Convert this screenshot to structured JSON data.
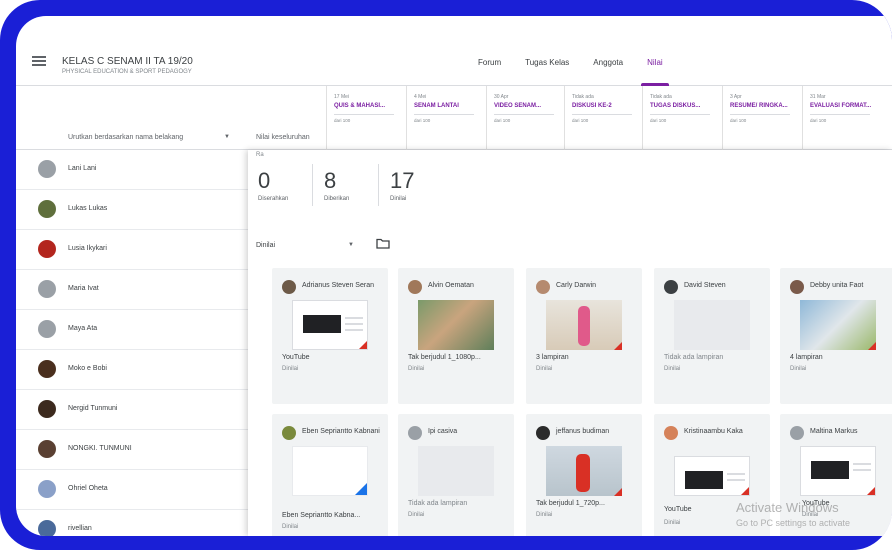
{
  "header": {
    "class_title": "KELAS C SENAM II TA 19/20",
    "class_subtitle": "PHYSICAL EDUCATION & SPORT PEDAGOGY",
    "tabs": [
      {
        "label": "Forum",
        "active": false
      },
      {
        "label": "Tugas Kelas",
        "active": false
      },
      {
        "label": "Anggota",
        "active": false
      },
      {
        "label": "Nilai",
        "active": true
      }
    ]
  },
  "grades": {
    "sort_label": "Urutkan berdasarkan nama belakang",
    "overall_label": "Nilai keseluruhan",
    "assignments": [
      {
        "due": "17 Mei",
        "name": "QUIS & MAHASI...",
        "max": "dari 100"
      },
      {
        "due": "4 Mei",
        "name": "SENAM LANTAI",
        "max": "dari 100"
      },
      {
        "due": "30 Apr",
        "name": "VIDEO SENAM...",
        "max": "dari 100"
      },
      {
        "due": "Tidak ada",
        "name": "DISKUSI KE-2",
        "max": "dari 100"
      },
      {
        "due": "Tidak ada",
        "name": "TUGAS DISKUS...",
        "max": "dari 100"
      },
      {
        "due": "3 Apr",
        "name": "RESUME/ RINGKA...",
        "max": "dari 100"
      },
      {
        "due": "31 Mar",
        "name": "EVALUASI FORMAT...",
        "max": "dari 100"
      }
    ]
  },
  "students": [
    {
      "name": "Lani Lani",
      "color": "#9aa0a6"
    },
    {
      "name": "Lukas Lukas",
      "color": "#5f6f3c"
    },
    {
      "name": "Lusia Ikykari",
      "color": "#b3261e"
    },
    {
      "name": "Maria Ivat",
      "color": "#9aa0a6"
    },
    {
      "name": "Maya Ata",
      "color": "#9aa0a6"
    },
    {
      "name": "Moko e Bobi",
      "color": "#4a2f1e"
    },
    {
      "name": "Nergid Tunmuni",
      "color": "#3c2a1e"
    },
    {
      "name": "NONGKI. TUNMUNI",
      "color": "#5a4032"
    },
    {
      "name": "Ohriel Oheta",
      "color": "#8aa0c8"
    },
    {
      "name": "rivellian",
      "color": "#4a6a9a"
    }
  ],
  "panel": {
    "top_label": "Ra",
    "stats": [
      {
        "value": "0",
        "label": "Diserahkan"
      },
      {
        "value": "8",
        "label": "Diberikan"
      },
      {
        "value": "17",
        "label": "Dinilai"
      }
    ],
    "filter_label": "Dinilai",
    "cards": [
      {
        "name": "Adrianus Steven Seran",
        "attachment": "YouTube",
        "status": "Dinilai",
        "thumb": "doc-red"
      },
      {
        "name": "Alvin Oematan",
        "attachment": "Tak berjudul 1_1080p...",
        "status": "Dinilai",
        "thumb": "photo"
      },
      {
        "name": "Carly Darwin",
        "attachment": "3 lampiran",
        "status": "Dinilai",
        "thumb": "photo-pink"
      },
      {
        "name": "David Steven",
        "attachment": "Tidak ada lampiran",
        "status": "Dinilai",
        "thumb": "blank"
      },
      {
        "name": "Debby unita Faot",
        "attachment": "4 lampiran",
        "status": "Dinilai",
        "thumb": "photo-blue"
      },
      {
        "name": "Eben Sepriantto Kabnani",
        "attachment": "Eben Sepriantto Kabna...",
        "status": "Dinilai",
        "thumb": "doc-blue"
      },
      {
        "name": "Ipi casiva",
        "attachment": "Tidak ada lampiran",
        "status": "Dinilai",
        "thumb": "blank"
      },
      {
        "name": "jeffanus budiman",
        "attachment": "Tak berjudul 1_720p...",
        "status": "Dinilai",
        "thumb": "photo-red"
      },
      {
        "name": "Kristinaambu Kaka",
        "attachment": "YouTube",
        "status": "Dinilai",
        "thumb": "doc-red"
      },
      {
        "name": "Maltina Markus",
        "attachment": "YouTube",
        "status": "Dinilai",
        "thumb": "doc-red"
      }
    ]
  },
  "watermark": {
    "line1": "Activate Windows",
    "line2": "Go to PC settings to activate"
  },
  "colors": {
    "frame": "#1a1fd6",
    "accent": "#7b1fa2"
  }
}
